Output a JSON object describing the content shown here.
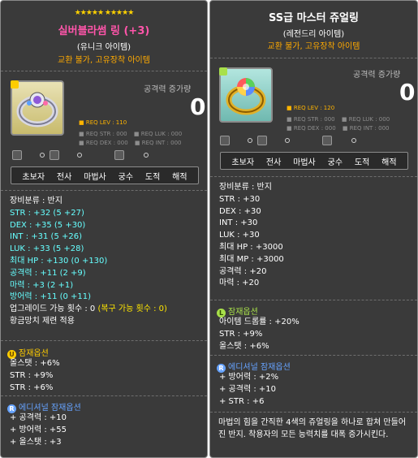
{
  "left": {
    "stars": "★★★★★ ★★★★★",
    "title": "실버블라썸 링 (+3)",
    "subtitle": "(유니크 아이템)",
    "restriction": "교환 불가, 고유장착 아이템",
    "attack_label": "공격력 증가량",
    "attack_value": "0",
    "req_lev": "REQ LEV : 110",
    "req_str": "REQ STR : 000",
    "req_luk": "REQ LUK : 000",
    "req_dex": "REQ DEX : 000",
    "req_int": "REQ INT : 000",
    "jobs": [
      "초보자",
      "전사",
      "마법사",
      "궁수",
      "도적",
      "해적"
    ],
    "stats": [
      "장비분류 : 반지",
      "STR : +32 (5 +27)",
      "DEX : +35 (5 +30)",
      "INT : +31 (5 +26)",
      "LUK : +33 (5 +28)",
      "최대 HP : +130 (0 +130)",
      "공격력 : +11 (2 +9)",
      "마력 : +3 (2 +1)",
      "방어력 : +11 (0 +11)",
      "업그레이드 가능 횟수 : 0",
      "(복구 가능 횟수 : 0)",
      "황금망치 제련 적용"
    ],
    "potential_title": "잠재옵션",
    "potential": [
      "올스탯 : +6%",
      "STR : +9%",
      "STR : +6%"
    ],
    "additional_title": "에디셔널 잠재옵션",
    "additional": [
      "+ 공격력 : +10",
      "+ 방어력 : +55",
      "+ 올스탯 : +3"
    ]
  },
  "right": {
    "title": "SS급 마스터 쥬얼링",
    "subtitle": "(레전드리 아이템)",
    "restriction": "교환 불가, 고유장착 아이템",
    "attack_label": "공격력 증가량",
    "attack_value": "0",
    "req_lev": "REQ LEV : 120",
    "req_str": "REQ STR : 000",
    "req_luk": "REQ LUK : 000",
    "req_dex": "REQ DEX : 000",
    "req_int": "REQ INT : 000",
    "jobs": [
      "초보자",
      "전사",
      "마법사",
      "궁수",
      "도적",
      "해적"
    ],
    "stats": [
      "장비분류 : 반지",
      "STR : +30",
      "DEX : +30",
      "INT : +30",
      "LUK : +30",
      "최대 HP : +3000",
      "최대 MP : +3000",
      "공격력 : +20",
      "마력 : +20"
    ],
    "potential_title": "잠재옵션",
    "potential": [
      "아이템 드롭률 : +20%",
      "STR : +9%",
      "올스탯 : +6%"
    ],
    "additional_title": "에디셔널 잠재옵션",
    "additional": [
      "+ 방어력 : +2%",
      "+ 공격력 : +10",
      "+ STR : +6"
    ],
    "description": "마법의 힘을 간직한 4색의 쥬얼링을 하나로 합쳐 만들어진 반지. 착용자의 모든 능력치를 대폭 증가시킨다."
  },
  "colors": {
    "title_unique": "#ff55aa",
    "title_legendary": "#ffffff",
    "restriction": "#ffaa00",
    "stat_bonus": "#66ffff",
    "potential_unique": "#ffcc00",
    "potential_legendary": "#a8e04a",
    "additional": "#66a3ff"
  },
  "icons": {
    "left_item": "silver-blossom-ring-icon",
    "right_item": "master-jewel-ring-icon"
  }
}
